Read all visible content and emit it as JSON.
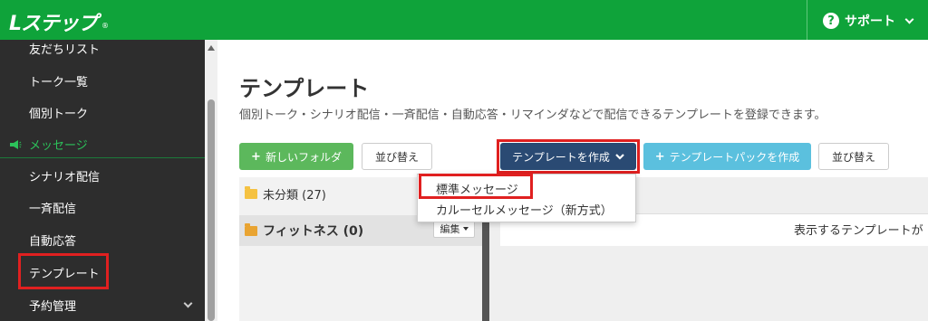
{
  "header": {
    "logo_text": "Lステップ",
    "logo_mark": "®",
    "support_label": "サポート",
    "help_icon_glyph": "?",
    "brand_color": "#0fa33a"
  },
  "sidebar": {
    "items": [
      {
        "label": "友だちリスト"
      },
      {
        "label": "トーク一覧"
      },
      {
        "label": "個別トーク"
      }
    ],
    "section_label": "メッセージ",
    "section_items": [
      {
        "label": "シナリオ配信"
      },
      {
        "label": "一斉配信"
      },
      {
        "label": "自動応答"
      },
      {
        "label": "テンプレート",
        "highlighted": true
      },
      {
        "label": "予約管理"
      }
    ]
  },
  "main": {
    "title": "テンプレート",
    "description": "個別トーク・シナリオ配信・一斉配信・自動応答・リマインダなどで配信できるテンプレートを登録できます。",
    "toolbar": {
      "new_folder_label": "新しいフォルダ",
      "sort_label": "並び替え",
      "create_template_label": "テンプレートを作成",
      "create_pack_label": "テンプレートパックを作成",
      "sort2_label": "並び替え"
    },
    "folders": [
      {
        "name": "未分類",
        "count": "(27)",
        "display": "未分類 (27)"
      },
      {
        "name": "フィットネス",
        "count": "(0)",
        "display": "フィットネス (0)"
      }
    ],
    "edit_label": "編集",
    "empty_message": "表示するテンプレートが",
    "dropdown": {
      "items": [
        {
          "label": "標準メッセージ",
          "highlighted": true
        },
        {
          "label": "カルーセルメッセージ（新方式）"
        }
      ]
    }
  },
  "colors": {
    "accent_red": "#e02020",
    "create_button": "#2a4a73",
    "new_folder_button": "#5cb85c",
    "pack_button": "#5bc0de"
  }
}
